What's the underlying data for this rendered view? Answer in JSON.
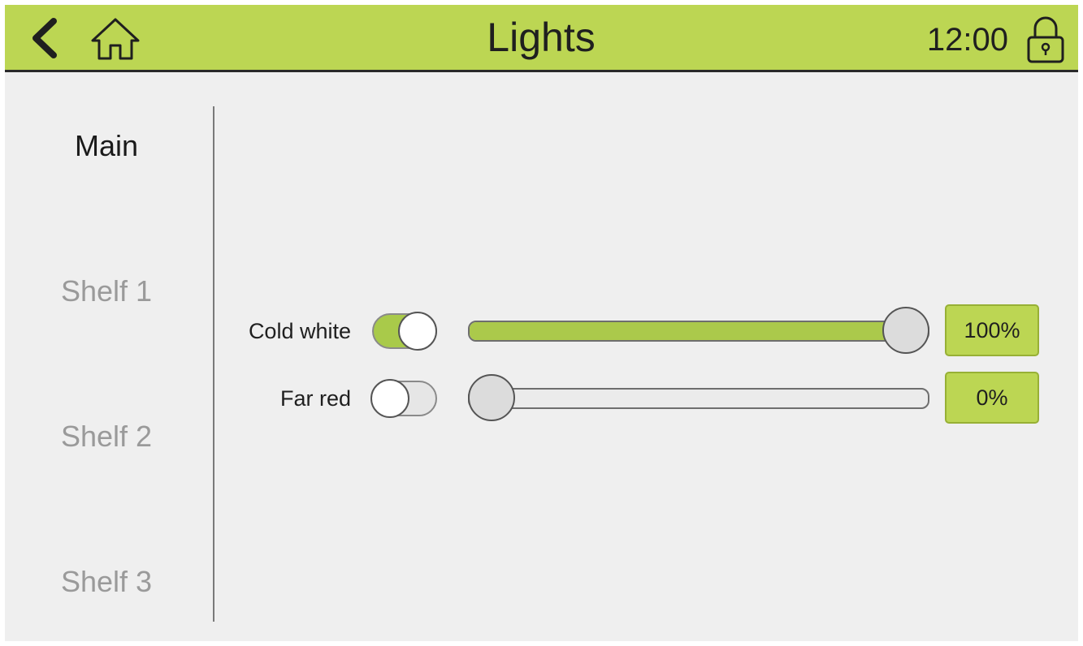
{
  "header": {
    "title": "Lights",
    "time": "12:00",
    "back_icon": "chevron-left-icon",
    "home_icon": "home-icon",
    "lock_icon": "lock-icon",
    "bar_color": "#bcd653"
  },
  "sidebar": {
    "items": [
      {
        "label": "Main",
        "active": true
      },
      {
        "label": "Shelf 1",
        "active": false
      },
      {
        "label": "Shelf 2",
        "active": false
      },
      {
        "label": "Shelf 3",
        "active": false
      }
    ]
  },
  "channels": [
    {
      "label": "Cold white",
      "enabled": true,
      "level_percent": 100,
      "value_text": "100%"
    },
    {
      "label": "Far red",
      "enabled": false,
      "level_percent": 0,
      "value_text": "0%"
    }
  ],
  "colors": {
    "accent": "#abc94b",
    "inactive_text": "#9a9a9a"
  }
}
